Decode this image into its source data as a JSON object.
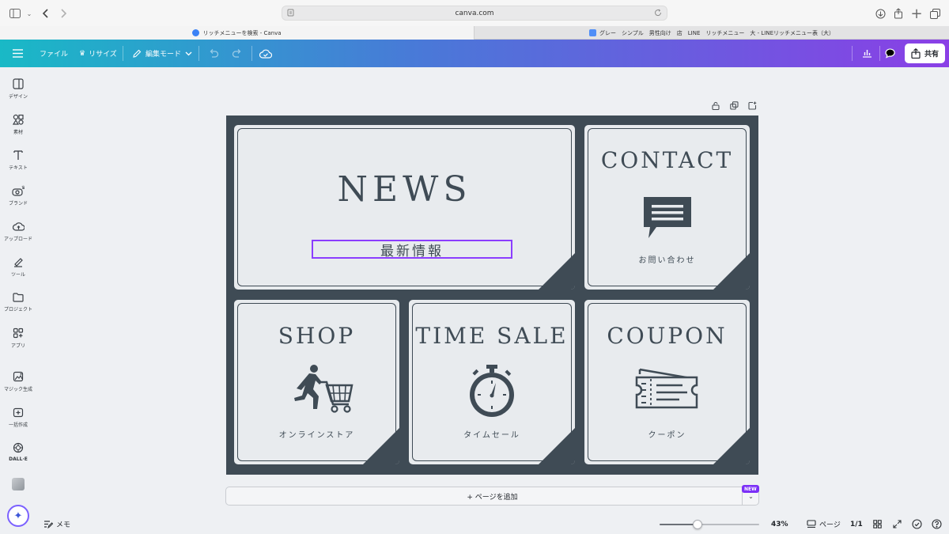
{
  "browser": {
    "address": "canva.com",
    "tabs": [
      {
        "label": "リッチメニューを検索 - Canva",
        "favicon_color": "#3b82f6"
      },
      {
        "label": "グレー　シンプル　男性向け　店　LINE　リッチメニュー　大 - LINEリッチメニュー表（大）",
        "favicon_color": "#4f8ef7"
      }
    ]
  },
  "toolbar": {
    "file_label": "ファイル",
    "resize_label": "リサイズ",
    "edit_mode_label": "編集モード",
    "share_label": "共有",
    "accent_colors": [
      "#19b9c6",
      "#4a78d8",
      "#8a3fe6"
    ]
  },
  "sidebar": {
    "items": [
      {
        "label": "デザイン",
        "icon": "design-icon"
      },
      {
        "label": "素材",
        "icon": "elements-icon"
      },
      {
        "label": "テキスト",
        "icon": "text-icon"
      },
      {
        "label": "ブランド",
        "icon": "brand-icon"
      },
      {
        "label": "アップロード",
        "icon": "upload-icon"
      },
      {
        "label": "ツール",
        "icon": "tools-icon"
      },
      {
        "label": "プロジェクト",
        "icon": "folder-icon"
      },
      {
        "label": "アプリ",
        "icon": "apps-icon"
      },
      {
        "label": "マジック生成",
        "icon": "magic-media-icon"
      },
      {
        "label": "一括作成",
        "icon": "bulk-create-icon"
      },
      {
        "label": "DALL·E",
        "icon": "dalle-icon"
      }
    ]
  },
  "design": {
    "bg_color": "#3f4b55",
    "panel_color": "#e8ebee",
    "panels": {
      "news": {
        "title": "NEWS",
        "subtitle": "最新情報"
      },
      "contact": {
        "title": "CONTACT",
        "subtitle": "お問い合わせ",
        "icon": "chat-bubble-icon"
      },
      "shop": {
        "title": "SHOP",
        "subtitle": "オンラインストア",
        "icon": "shopping-cart-icon"
      },
      "timesale": {
        "title": "TIME SALE",
        "subtitle": "タイムセール",
        "icon": "stopwatch-icon"
      },
      "coupon": {
        "title": "COUPON",
        "subtitle": "クーポン",
        "icon": "ticket-icon"
      }
    }
  },
  "add_page": {
    "label": "+ ページを追加",
    "badge": "NEW"
  },
  "bottom": {
    "notes_label": "メモ",
    "zoom": "43%",
    "zoom_fraction": 0.38,
    "pages_label": "ページ",
    "page_count": "1/1"
  }
}
